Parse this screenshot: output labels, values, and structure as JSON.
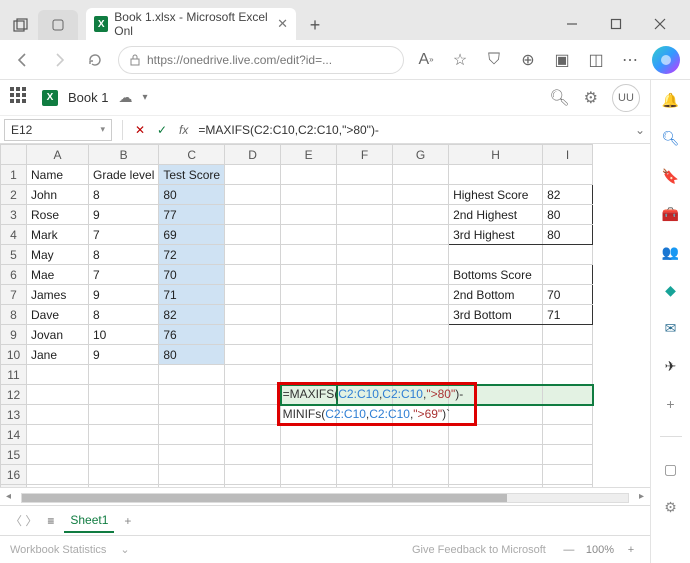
{
  "browser": {
    "tab_title": "Book 1.xlsx - Microsoft Excel Onl",
    "url": "https://onedrive.live.com/edit?id=..."
  },
  "app": {
    "file_name": "Book 1",
    "avatar_initials": "UU"
  },
  "formula_bar": {
    "name_box": "E12",
    "formula_display": "=MAXIFS(C2:C10,C2:C10,\">80\")-"
  },
  "columns": [
    "A",
    "B",
    "C",
    "D",
    "E",
    "F",
    "G",
    "H",
    "I"
  ],
  "headers": {
    "A1": "Name",
    "B1": "Grade level",
    "C1": "Test Score"
  },
  "data_rows": [
    {
      "name": "John",
      "grade": "8",
      "score": "80"
    },
    {
      "name": "Rose",
      "grade": "9",
      "score": "77"
    },
    {
      "name": "Mark",
      "grade": "7",
      "score": "69"
    },
    {
      "name": "May",
      "grade": "8",
      "score": "72"
    },
    {
      "name": "Mae",
      "grade": "7",
      "score": "70"
    },
    {
      "name": "James",
      "grade": "9",
      "score": "71"
    },
    {
      "name": "Dave",
      "grade": "8",
      "score": "82"
    },
    {
      "name": "Jovan",
      "grade": "10",
      "score": "76"
    },
    {
      "name": "Jane",
      "grade": "9",
      "score": "80"
    }
  ],
  "summary_top": [
    {
      "label": "Highest Score",
      "value": "82"
    },
    {
      "label": "2nd Highest",
      "value": "80"
    },
    {
      "label": "3rd Highest",
      "value": "80"
    }
  ],
  "summary_bottom": [
    {
      "label": "Bottoms Score",
      "value": ""
    },
    {
      "label": "2nd Bottom",
      "value": "70"
    },
    {
      "label": "3rd Bottom",
      "value": "71"
    }
  ],
  "overlay_formula": {
    "line1_pre": "=MAXIFS(",
    "ref": "C2:C10",
    "comma": ",",
    "str80": "\">80\"",
    "line1_post": ")-",
    "line2_pre": "MINIFs(",
    "str69": "\">69\"",
    "line2_post": ")`"
  },
  "sheet_tabs": {
    "active": "Sheet1"
  },
  "status": {
    "workbook_stats": "Workbook Statistics",
    "feedback": "Give Feedback to Microsoft",
    "zoom": "100%"
  }
}
